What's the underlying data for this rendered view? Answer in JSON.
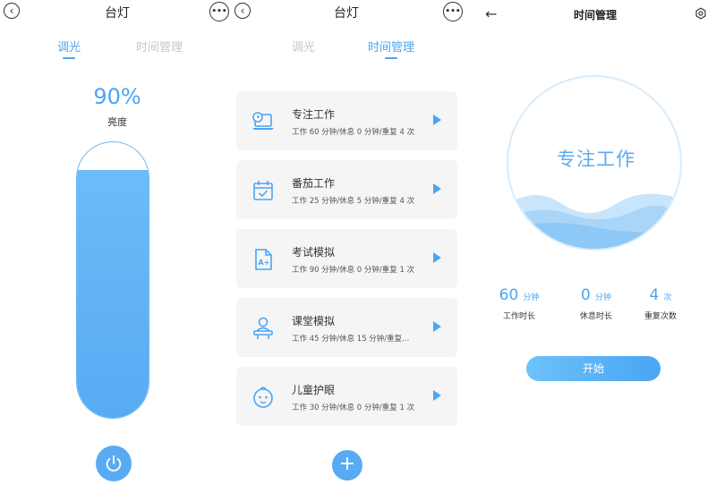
{
  "screen1": {
    "title": "台灯",
    "tabs": [
      {
        "label": "调光",
        "active": true
      },
      {
        "label": "时间管理",
        "active": false
      }
    ],
    "brightness_text": "90%",
    "brightness_level": 0.9,
    "brightness_label": "亮度"
  },
  "screen2": {
    "title": "台灯",
    "tabs": [
      {
        "label": "调光",
        "active": false
      },
      {
        "label": "时间管理",
        "active": true
      }
    ],
    "modes": [
      {
        "icon": "laptop-clock-icon",
        "title": "专注工作",
        "subtitle": "工作 60 分钟/休息 0 分钟/重复 4 次"
      },
      {
        "icon": "calendar-check-icon",
        "title": "番茄工作",
        "subtitle": "工作 25 分钟/休息 5 分钟/重复 4 次"
      },
      {
        "icon": "exam-grade-icon",
        "title": "考试模拟",
        "subtitle": "工作 90 分钟/休息 0 分钟/重复 1 次"
      },
      {
        "icon": "classroom-student-icon",
        "title": "课堂模拟",
        "subtitle": "工作 45 分钟/休息 15 分钟/重复..."
      },
      {
        "icon": "child-face-icon",
        "title": "儿童护眼",
        "subtitle": "工作 30 分钟/休息 0 分钟/重复 1 次"
      }
    ]
  },
  "screen3": {
    "title": "时间管理",
    "circle_text": "专注工作",
    "stats": [
      {
        "value": "60",
        "unit": "分钟",
        "label": "工作时长"
      },
      {
        "value": "0",
        "unit": "分钟",
        "label": "休息时长"
      },
      {
        "value": "4",
        "unit": "次",
        "label": "重复次数"
      }
    ],
    "start_label": "开始"
  },
  "colors": {
    "accent": "#4aa5f3",
    "card_bg": "#f5f5f5",
    "inactive_tab": "#c7c7c7"
  }
}
